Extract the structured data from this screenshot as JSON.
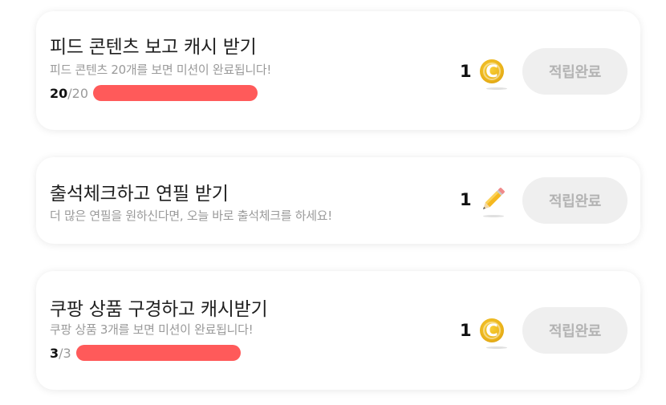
{
  "missions": [
    {
      "title": "피드 콘텐츠 보고 캐시 받기",
      "subtitle": "피드 콘텐츠 20개를 보면 미션이 완료됩니다!",
      "progress_current": "20",
      "progress_total": "/20",
      "progress_fraction": 1.0,
      "reward_count": "1",
      "reward_icon": "coin-icon",
      "reward_glyph": "C",
      "button_label": "적립완료"
    },
    {
      "title": "출석체크하고 연필 받기",
      "subtitle": "더 많은 연필을 원하신다면, 오늘 바로 출석체크를 하세요!",
      "reward_count": "1",
      "reward_icon": "pencil-icon",
      "button_label": "적립완료"
    },
    {
      "title": "쿠팡 상품 구경하고 캐시받기",
      "subtitle": "쿠팡 상품 3개를 보면 미션이 완료됩니다!",
      "progress_current": "3",
      "progress_total": "/3",
      "progress_fraction": 1.0,
      "reward_count": "1",
      "reward_icon": "coin-icon",
      "reward_glyph": "C",
      "button_label": "적립완료"
    }
  ],
  "colors": {
    "progress_bar": "#ff5a5a",
    "coin": "#f1bc22",
    "button_bg": "#efefef",
    "button_text": "#b3b3b3"
  }
}
